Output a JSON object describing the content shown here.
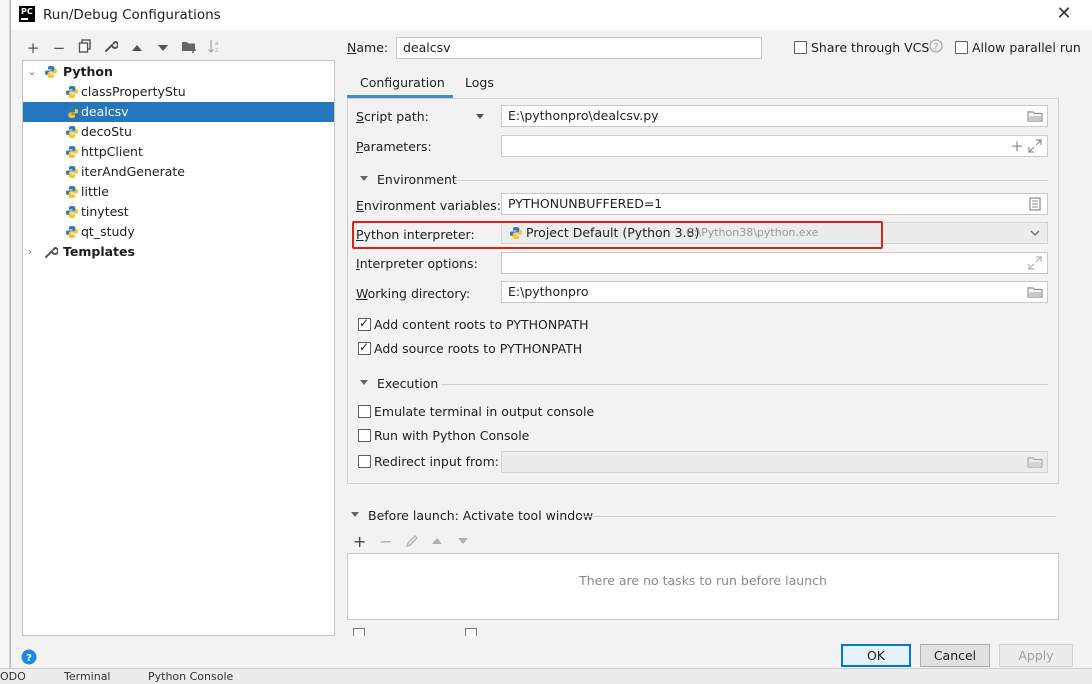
{
  "window": {
    "title": "Run/Debug Configurations",
    "app_icon_text": "PC"
  },
  "toolbar": {
    "icons": [
      "plus-icon",
      "minus-icon",
      "copy-icon",
      "wrench-icon",
      "move-up-icon",
      "move-down-icon",
      "folder-add-icon",
      "sort-icon"
    ]
  },
  "tree": {
    "python_group": "Python",
    "items": [
      "classPropertyStu",
      "dealcsv",
      "decoStu",
      "httpClient",
      "iterAndGenerate",
      "little",
      "tinytest",
      "qt_study"
    ],
    "selected": "dealcsv",
    "templates": "Templates"
  },
  "header": {
    "name_label": "Name:",
    "name_value": "dealcsv",
    "share_label": "Share through VCS",
    "parallel_label": "Allow parallel run"
  },
  "tabs": {
    "configuration": "Configuration",
    "logs": "Logs"
  },
  "form": {
    "script_path_label": "Script path:",
    "script_path_value": "E:\\pythonpro\\dealcsv.py",
    "parameters_label": "Parameters:",
    "parameters_value": "",
    "environment_section": "Environment",
    "env_vars_label": "Environment variables:",
    "env_vars_value": "PYTHONUNBUFFERED=1",
    "interpreter_label": "Python interpreter:",
    "interpreter_value": "Project Default (Python 3.8)",
    "interpreter_path": "C:\\Python38\\python.exe",
    "interp_options_label": "Interpreter options:",
    "interp_options_value": "",
    "working_dir_label": "Working directory:",
    "working_dir_value": "E:\\pythonpro",
    "content_roots_label": "Add content roots to PYTHONPATH",
    "content_roots_checked": true,
    "source_roots_label": "Add source roots to PYTHONPATH",
    "source_roots_checked": true,
    "execution_section": "Execution",
    "emulate_terminal_label": "Emulate terminal in output console",
    "python_console_label": "Run with Python Console",
    "redirect_input_label": "Redirect input from:",
    "redirect_input_value": ""
  },
  "before_launch": {
    "title": "Before launch: Activate tool window",
    "empty_text": "There are no tasks to run before launch"
  },
  "buttons": {
    "ok": "OK",
    "cancel": "Cancel",
    "apply": "Apply"
  },
  "background": {
    "bottom_items": [
      "ODO",
      "Terminal",
      "Python Console"
    ]
  },
  "colors": {
    "selection": "#2675bf",
    "highlight_box": "#e0201c",
    "help_icon": "#1e88e5"
  }
}
